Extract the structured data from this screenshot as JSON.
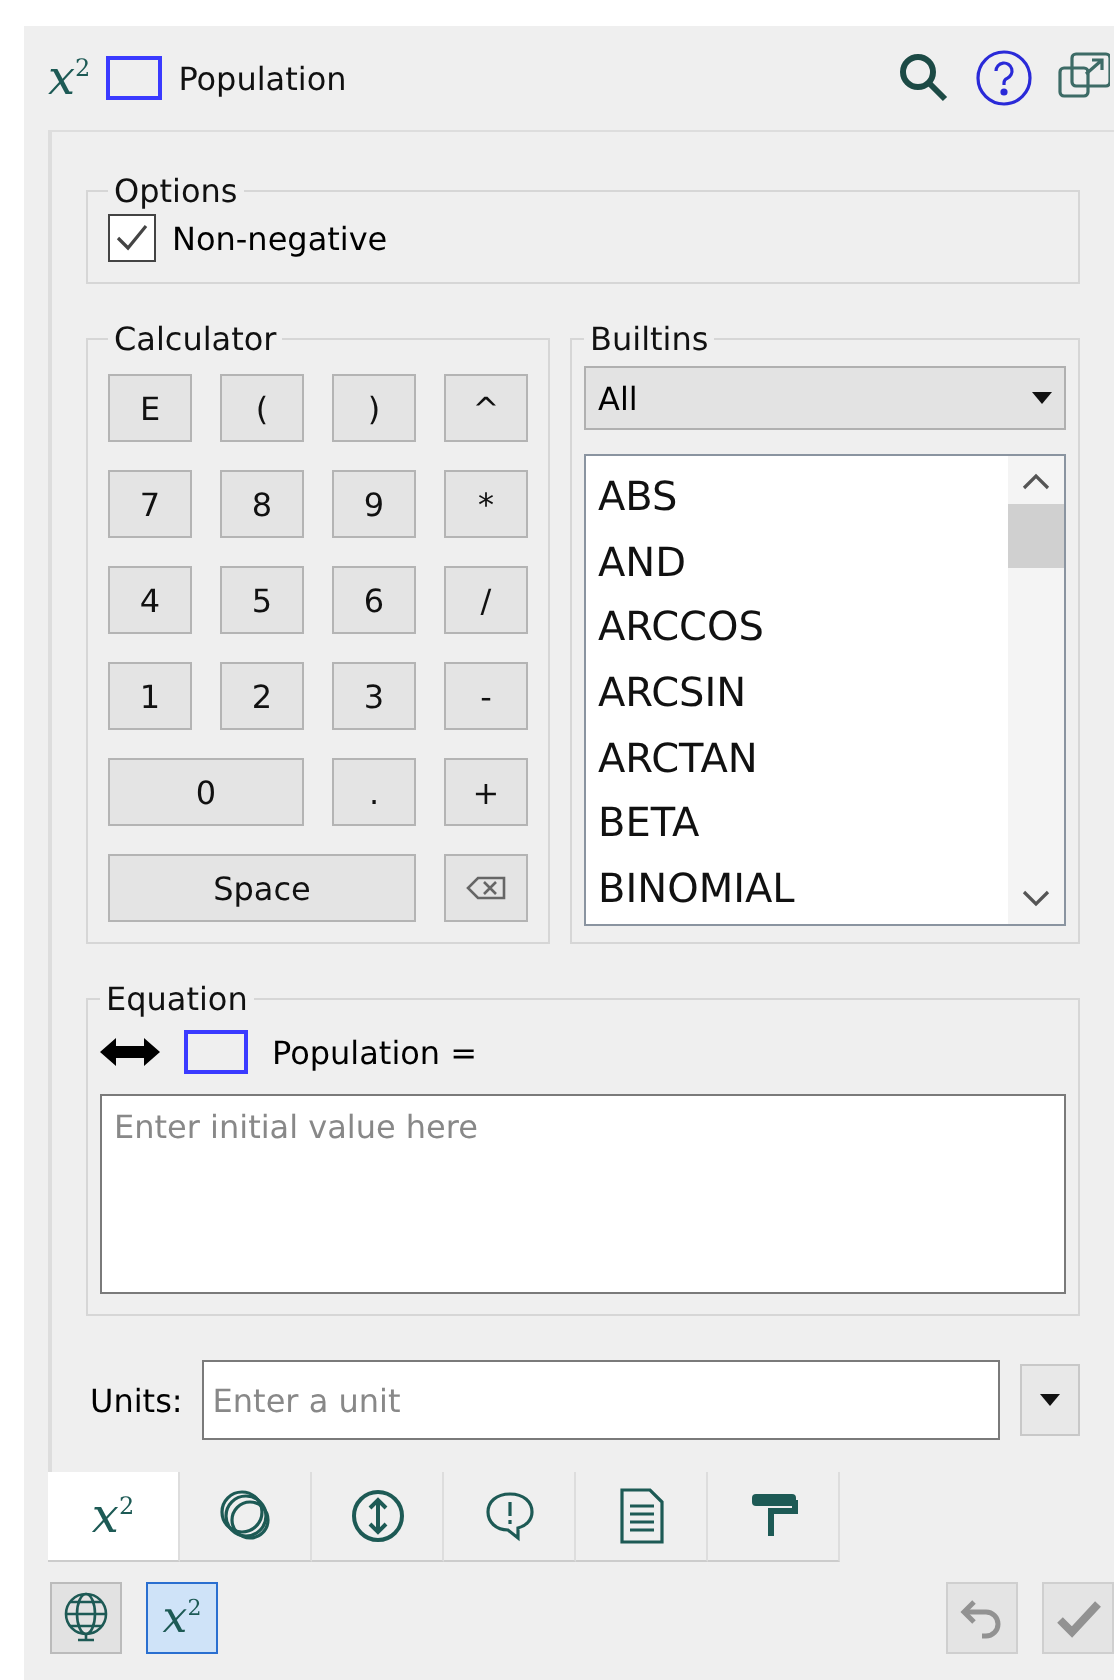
{
  "header": {
    "logo": "x$^{2}$",
    "name": "Population"
  },
  "options": {
    "title": "Options",
    "non_negative": {
      "label": "Non-negative",
      "checked": true
    }
  },
  "calculator": {
    "title": "Calculator",
    "keys": [
      {
        "label": "E",
        "kind": "key"
      },
      {
        "label": "(",
        "kind": "key"
      },
      {
        "label": ")",
        "kind": "key"
      },
      {
        "label": "^",
        "kind": "key"
      },
      {
        "label": "7",
        "kind": "key"
      },
      {
        "label": "8",
        "kind": "key"
      },
      {
        "label": "9",
        "kind": "key"
      },
      {
        "label": "*",
        "kind": "key"
      },
      {
        "label": "4",
        "kind": "key"
      },
      {
        "label": "5",
        "kind": "key"
      },
      {
        "label": "6",
        "kind": "key"
      },
      {
        "label": "/",
        "kind": "key"
      },
      {
        "label": "1",
        "kind": "key"
      },
      {
        "label": "2",
        "kind": "key"
      },
      {
        "label": "3",
        "kind": "key"
      },
      {
        "label": "-",
        "kind": "key"
      },
      {
        "label": "0",
        "kind": "wide"
      },
      {
        "label": ".",
        "kind": "key"
      },
      {
        "label": "+",
        "kind": "key"
      },
      {
        "label": "Space",
        "kind": "wide3"
      },
      {
        "kind": "backspace"
      }
    ]
  },
  "builtins": {
    "title": "Builtins",
    "filter": "All",
    "items": [
      "ABS",
      "AND",
      "ARCCOS",
      "ARCSIN",
      "ARCTAN",
      "BETA",
      "BINOMIAL"
    ]
  },
  "equation": {
    "title": "Equation",
    "lhs": "Population =",
    "placeholder": "Enter initial value here"
  },
  "units": {
    "label": "Units:",
    "placeholder": "Enter a unit"
  },
  "tabs": [
    {
      "kind": "equation",
      "label": "x$^{2}$",
      "selected": true
    },
    {
      "kind": "circles",
      "selected": false
    },
    {
      "kind": "range",
      "selected": false
    },
    {
      "kind": "alert",
      "selected": false
    },
    {
      "kind": "document",
      "selected": false
    },
    {
      "kind": "paint",
      "selected": false
    }
  ],
  "footer": [
    {
      "kind": "globe",
      "selected": false,
      "disabled": false
    },
    {
      "kind": "equation",
      "label": "x$^{2}$",
      "selected": true,
      "disabled": false
    },
    {
      "kind": "undo",
      "selected": false,
      "disabled": true
    },
    {
      "kind": "ok",
      "selected": false,
      "disabled": true
    }
  ]
}
